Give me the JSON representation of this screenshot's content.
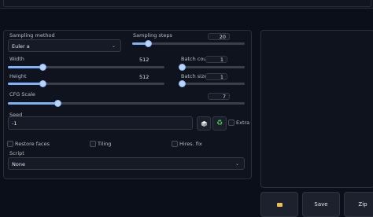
{
  "sampling_method": {
    "label": "Sampling method",
    "value": "Euler a"
  },
  "sampling_steps": {
    "label": "Sampling steps",
    "value": "20",
    "fraction": 0.14
  },
  "width": {
    "label": "Width",
    "value": "512",
    "fraction": 0.22
  },
  "height": {
    "label": "Height",
    "value": "512",
    "fraction": 0.22
  },
  "batch_count": {
    "label": "Batch count",
    "value": "1",
    "fraction": 0.0
  },
  "batch_size": {
    "label": "Batch size",
    "value": "1",
    "fraction": 0.0
  },
  "cfg_scale": {
    "label": "CFG Scale",
    "value": "7",
    "fraction": 0.21
  },
  "seed": {
    "label": "Seed",
    "value": "-1",
    "extra_label": "Extra"
  },
  "options": {
    "restore_faces": "Restore faces",
    "tiling": "Tiling",
    "hires_fix": "Hires. fix"
  },
  "script": {
    "label": "Script",
    "value": "None"
  },
  "buttons": {
    "save": "Save",
    "zip": "Zip"
  },
  "colors": {
    "slider_fill": "#7fb3f5",
    "recycle": "#4cd05a"
  }
}
